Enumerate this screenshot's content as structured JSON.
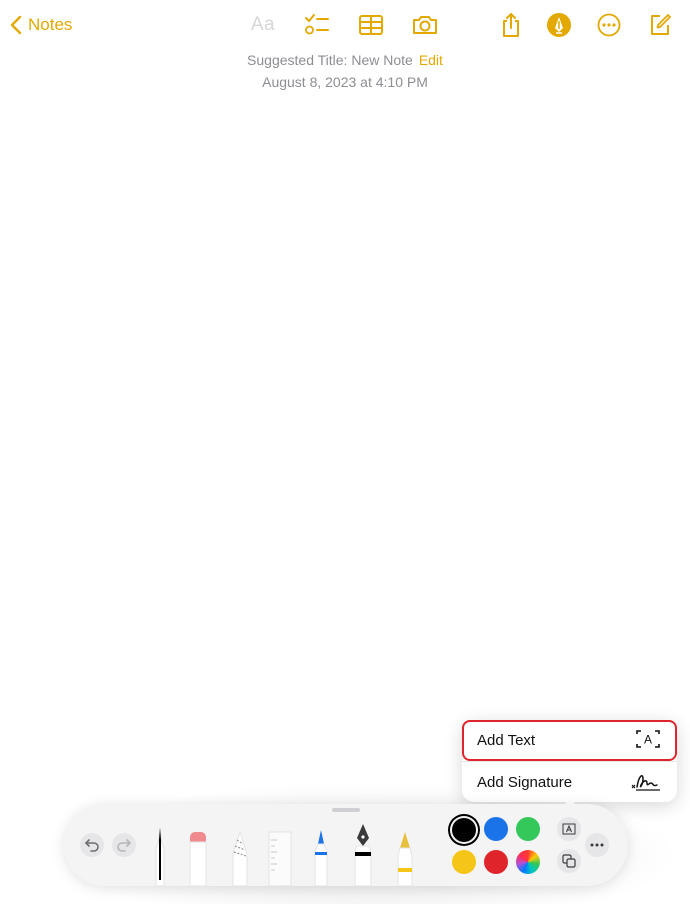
{
  "topbar": {
    "back_label": "Notes",
    "format_label": "Aa"
  },
  "note": {
    "suggested_title": "Suggested Title: New Note",
    "edit_label": "Edit",
    "datetime": "August 8, 2023 at 4:10 PM"
  },
  "popup": {
    "add_text_label": "Add Text",
    "add_signature_label": "Add Signature",
    "text_icon_letter": "A"
  },
  "colors": {
    "accent": "#e3a900",
    "swatches": [
      "#000000",
      "#1a73e8",
      "#34c759",
      "#f5c518",
      "#e0242c",
      "multicolor"
    ],
    "highlight": "#e0242c"
  }
}
